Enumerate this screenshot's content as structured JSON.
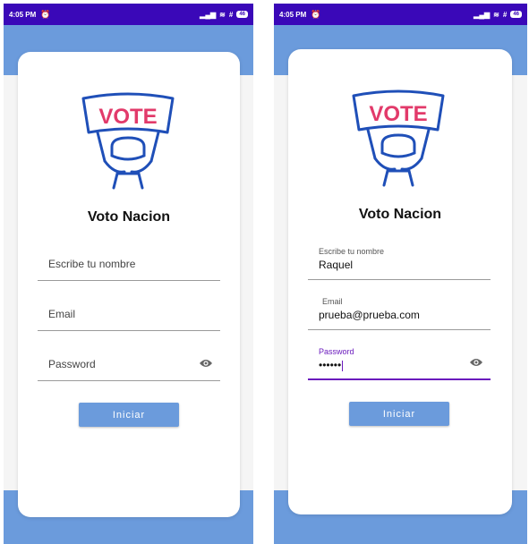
{
  "screens": [
    {
      "status": {
        "time": "4:05 PM",
        "battery": "46"
      },
      "app_title": "Voto Nacion",
      "logo": {
        "banner_text": "VOTE",
        "banner_color": "#e23a6a",
        "outline_color": "#1f4fb8"
      },
      "fields": {
        "name": {
          "placeholder": "Escribe tu nombre",
          "label": "",
          "value": ""
        },
        "email": {
          "placeholder": "Email",
          "label": "",
          "value": ""
        },
        "password": {
          "placeholder": "Password",
          "label": "",
          "value": "",
          "icon": "eye-icon"
        }
      },
      "button_label": "Iniciar"
    },
    {
      "status": {
        "time": "4:05 PM",
        "battery": "46"
      },
      "app_title": "Voto Nacion",
      "logo": {
        "banner_text": "VOTE",
        "banner_color": "#e23a6a",
        "outline_color": "#1f4fb8"
      },
      "fields": {
        "name": {
          "label": "Escribe tu nombre",
          "value": "Raquel"
        },
        "email": {
          "label": "Email",
          "value": "prueba@prueba.com"
        },
        "password": {
          "label": "Password",
          "value": "••••••",
          "focused": true,
          "icon": "eye-icon"
        }
      },
      "button_label": "Iniciar"
    }
  ],
  "colors": {
    "status_bar": "#3a08b8",
    "accent": "#6b9bdc",
    "focus": "#6a1bbd"
  }
}
